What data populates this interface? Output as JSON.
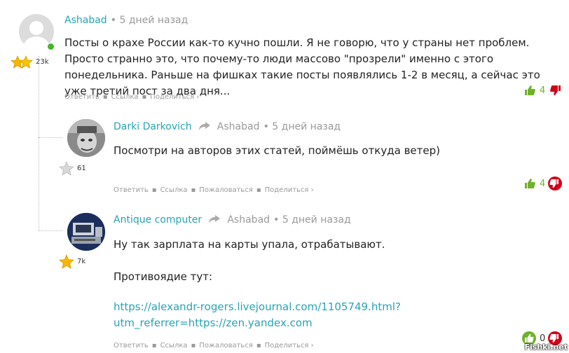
{
  "comments": [
    {
      "author": "Ashabad",
      "time": "5 дней назад",
      "rating": "23k",
      "text": "Посты о крахе России как-то кучно пошли. Я не говорю, что у страны нет проблем. Просто странно это, что почему-то люди массово \"прозрели\" именно с этого понедельника. Раньше на фишках такие посты появлялись 1-2 в месяц, а сейчас это уже третий пост за два дня...",
      "actions": [
        "Ответить",
        "Ссылка",
        "Поделиться ›"
      ],
      "votes": "4"
    },
    {
      "author": "Darki Darkovich",
      "reply_to": "Ashabad",
      "time": "5 дней назад",
      "rating": "61",
      "text": "Посмотри на авторов этих статей, поймёшь откуда ветер)",
      "actions": [
        "Ответить",
        "Ссылка",
        "Пожаловаться",
        "Поделиться ›"
      ],
      "votes": "4"
    },
    {
      "author": "Antique computer",
      "reply_to": "Ashabad",
      "time": "5 дней назад",
      "rating": "7k",
      "text1": "Ну так зарплата на карты упала, отрабатывают.",
      "text2": "Противоядие тут:",
      "link_line1": "https://alexandr-rogers.livejournal.com/1105749.html?",
      "link_line2": "utm_referrer=https://zen.yandex.com",
      "actions": [
        "Ответить",
        "Ссылка",
        "Пожаловаться",
        "Поделиться ›"
      ],
      "votes": "0"
    }
  ],
  "watermark": "Fishki.net",
  "colors": {
    "accent": "#26a3b3",
    "like": "#6fb22a",
    "dislike": "#d0021b",
    "star": "#f5b800"
  }
}
